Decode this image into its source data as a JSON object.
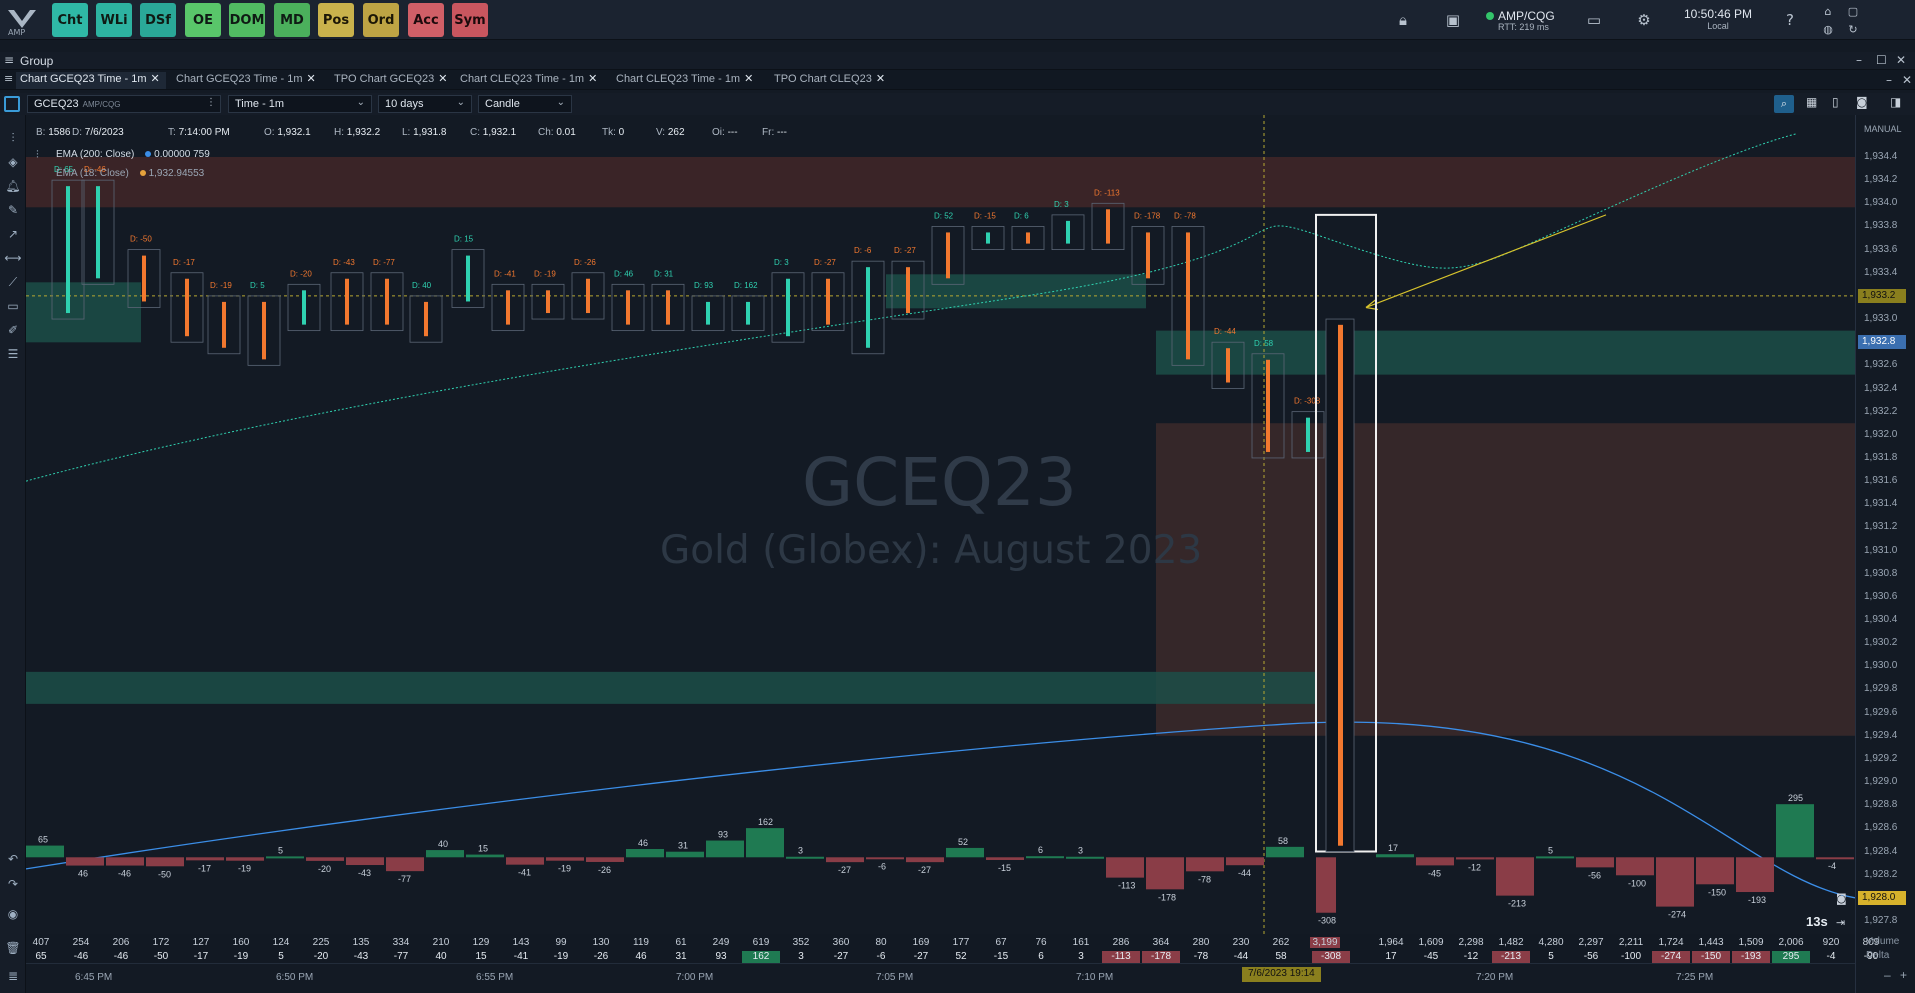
{
  "toolbar": {
    "logo": "AMP",
    "apps": [
      {
        "label": "Cht",
        "bg": "#2fb8a6",
        "fg": "#0f1a14"
      },
      {
        "label": "WLi",
        "bg": "#2db3a1",
        "fg": "#0f1a14"
      },
      {
        "label": "DSf",
        "bg": "#2aa898",
        "fg": "#0f1a14"
      },
      {
        "label": "OE",
        "bg": "#59c66a",
        "fg": "#0f1a14"
      },
      {
        "label": "DOM",
        "bg": "#51bb62",
        "fg": "#0f1a14"
      },
      {
        "label": "MD",
        "bg": "#4bb05c",
        "fg": "#0f1a14"
      },
      {
        "label": "Pos",
        "bg": "#c9b24c",
        "fg": "#1c1706"
      },
      {
        "label": "Ord",
        "bg": "#bea444",
        "fg": "#1c1706"
      },
      {
        "label": "Acc",
        "bg": "#d05f67",
        "fg": "#1c0a0c"
      },
      {
        "label": "Sym",
        "bg": "#c9565f",
        "fg": "#1c0a0c"
      }
    ],
    "connection": {
      "name": "AMP/CQG",
      "rtt": "RTT: 219 ms"
    },
    "clock": {
      "time": "10:50:46 PM",
      "zone": "Local"
    }
  },
  "group": {
    "label": "Group"
  },
  "tabs": [
    {
      "label": "Chart GCEQ23 Time - 1m",
      "active": true
    },
    {
      "label": "Chart GCEQ23 Time - 1m",
      "active": false
    },
    {
      "label": "TPO Chart GCEQ23",
      "active": false
    },
    {
      "label": "Chart CLEQ23 Time - 1m",
      "active": false
    },
    {
      "label": "Chart CLEQ23 Time - 1m",
      "active": false
    },
    {
      "label": "TPO Chart CLEQ23",
      "active": false
    }
  ],
  "chart_toolbar": {
    "symbol": "GCEQ23",
    "symbol_sub": "AMP/CQG",
    "interval": "Time - 1m",
    "range": "10 days",
    "style": "Candle"
  },
  "info": {
    "b_label": "B:",
    "b": "1586",
    "d_label": "D:",
    "d": "7/6/2023",
    "t_label": "T:",
    "t": "7:14:00 PM",
    "o_label": "O:",
    "o": "1,932.1",
    "h_label": "H:",
    "h": "1,932.2",
    "l_label": "L:",
    "l": "1,931.8",
    "c_label": "C:",
    "c": "1,932.1",
    "ch_label": "Ch:",
    "ch": "0.01",
    "tk_label": "Tk:",
    "tk": "0",
    "v_label": "V:",
    "v": "262",
    "oi_label": "Oi:",
    "oi": "---",
    "fr_label": "Fr:",
    "fr": "---"
  },
  "indicators": {
    "ema1_label": "EMA (200: Close)",
    "ema1_value": "0.00000 759",
    "ema1_color": "#3b8ee8",
    "ema2_label": "EMA (18: Close)",
    "ema2_value": "1,932.94553",
    "ema2_color": "#e6a23c"
  },
  "watermark": {
    "symbol": "GCEQ23",
    "name": "Gold (Globex): August 2023"
  },
  "timer": "13s",
  "price_axis": {
    "manual": "MANUAL",
    "ticks": [
      "1,934.4",
      "1,934.2",
      "1,934.0",
      "1,933.8",
      "1,933.6",
      "1,933.4",
      "1,933.0",
      "1,932.6",
      "1,932.4",
      "1,932.2",
      "1,932.0",
      "1,931.8",
      "1,931.6",
      "1,931.4",
      "1,931.2",
      "1,931.0",
      "1,930.8",
      "1,930.6",
      "1,930.4",
      "1,930.2",
      "1,930.0",
      "1,929.8",
      "1,929.6",
      "1,929.4",
      "1,929.2",
      "1,929.0",
      "1,928.8",
      "1,928.6",
      "1,928.4",
      "1,928.2",
      "1,927.8"
    ],
    "current_price": "1,932.8",
    "cursor_price": "1,933.2",
    "low_price": "1,928.0"
  },
  "rows": {
    "volume_label": "Volume",
    "delta_label": "Delta",
    "volume": [
      "407",
      "254",
      "206",
      "172",
      "127",
      "160",
      "124",
      "225",
      "135",
      "334",
      "210",
      "129",
      "143",
      "99",
      "130",
      "119",
      "61",
      "249",
      "619",
      "352",
      "360",
      "80",
      "169",
      "177",
      "67",
      "76",
      "161",
      "286",
      "364",
      "280",
      "230",
      "262",
      "3,199",
      "1,964",
      "1,609",
      "2,298",
      "1,482",
      "4,280",
      "2,297",
      "2,211",
      "1,724",
      "1,443",
      "1,509",
      "2,006",
      "920",
      "809"
    ],
    "delta": [
      "65",
      "-46",
      "-46",
      "-50",
      "-17",
      "-19",
      "5",
      "-20",
      "-43",
      "-77",
      "40",
      "15",
      "-41",
      "-19",
      "-26",
      "46",
      "31",
      "93",
      "162",
      "3",
      "-27",
      "-6",
      "-27",
      "52",
      "-15",
      "6",
      "3",
      "-113",
      "-178",
      "-78",
      "-44",
      "58",
      "-308",
      "17",
      "-45",
      "-12",
      "-213",
      "5",
      "-56",
      "-100",
      "-274",
      "-150",
      "-193",
      "295",
      "-4",
      "-90"
    ]
  },
  "delta_hist": {
    "values": [
      65,
      -46,
      -46,
      -50,
      -17,
      -19,
      5,
      -20,
      -43,
      -77,
      40,
      15,
      -41,
      -19,
      -26,
      46,
      31,
      93,
      162,
      3,
      -27,
      -6,
      -27,
      52,
      -15,
      6,
      3,
      -113,
      -178,
      -78,
      -44,
      58,
      -308,
      17,
      -45,
      -12,
      -213,
      5,
      -56,
      -100,
      -274,
      -150,
      -193,
      295,
      -4,
      -90
    ],
    "labels_top": [
      "65",
      "46",
      "-46",
      "-50",
      "-17",
      "-19",
      "5",
      "-20",
      "-43",
      "-77",
      "40",
      "15",
      "-41",
      "-19",
      "-26",
      "46",
      "31",
      "93",
      "162",
      "3",
      "-27",
      "-6",
      "-27",
      "52",
      "-15",
      "6",
      "3",
      "-113",
      "-178",
      "-78",
      "-44",
      "58",
      "-308",
      "17",
      "-45",
      "-12",
      "-213",
      "5",
      "-56",
      "-100",
      "-274",
      "-150",
      "-193",
      "295",
      "-4",
      "-90"
    ]
  },
  "time_axis": {
    "labels": [
      "6:45 PM",
      "6:50 PM",
      "6:55 PM",
      "7:00 PM",
      "7:05 PM",
      "7:10 PM",
      "7:15 PM",
      "7:20 PM",
      "7:25 PM"
    ],
    "cursor": "7/6/2023 19:14"
  },
  "footprint_deltas": [
    "D: 65",
    "D: -46",
    "D: -50",
    "D: -17",
    "D: -19",
    "D: 5",
    "D: -20",
    "D: -43",
    "D: -77",
    "D: 40",
    "D: 15",
    "D: -41",
    "D: -19",
    "D: -26",
    "D: 46",
    "D: 31",
    "D: 93",
    "D: 162",
    "D: 3",
    "D: -27",
    "D: -6",
    "D: -27",
    "D: 52",
    "D: -15",
    "D: 6",
    "D: 3",
    "D: -113",
    "D: -178",
    "D: -78",
    "D: -44",
    "D: 58",
    "D: -308"
  ],
  "colors": {
    "bg": "#131a24",
    "bull": "#2a9d6c",
    "bear": "#b04a55",
    "candle_up": "#2fd1b0",
    "candle_down": "#f2782f",
    "zone_green": "#1f5a52",
    "zone_red": "#5a3230"
  }
}
